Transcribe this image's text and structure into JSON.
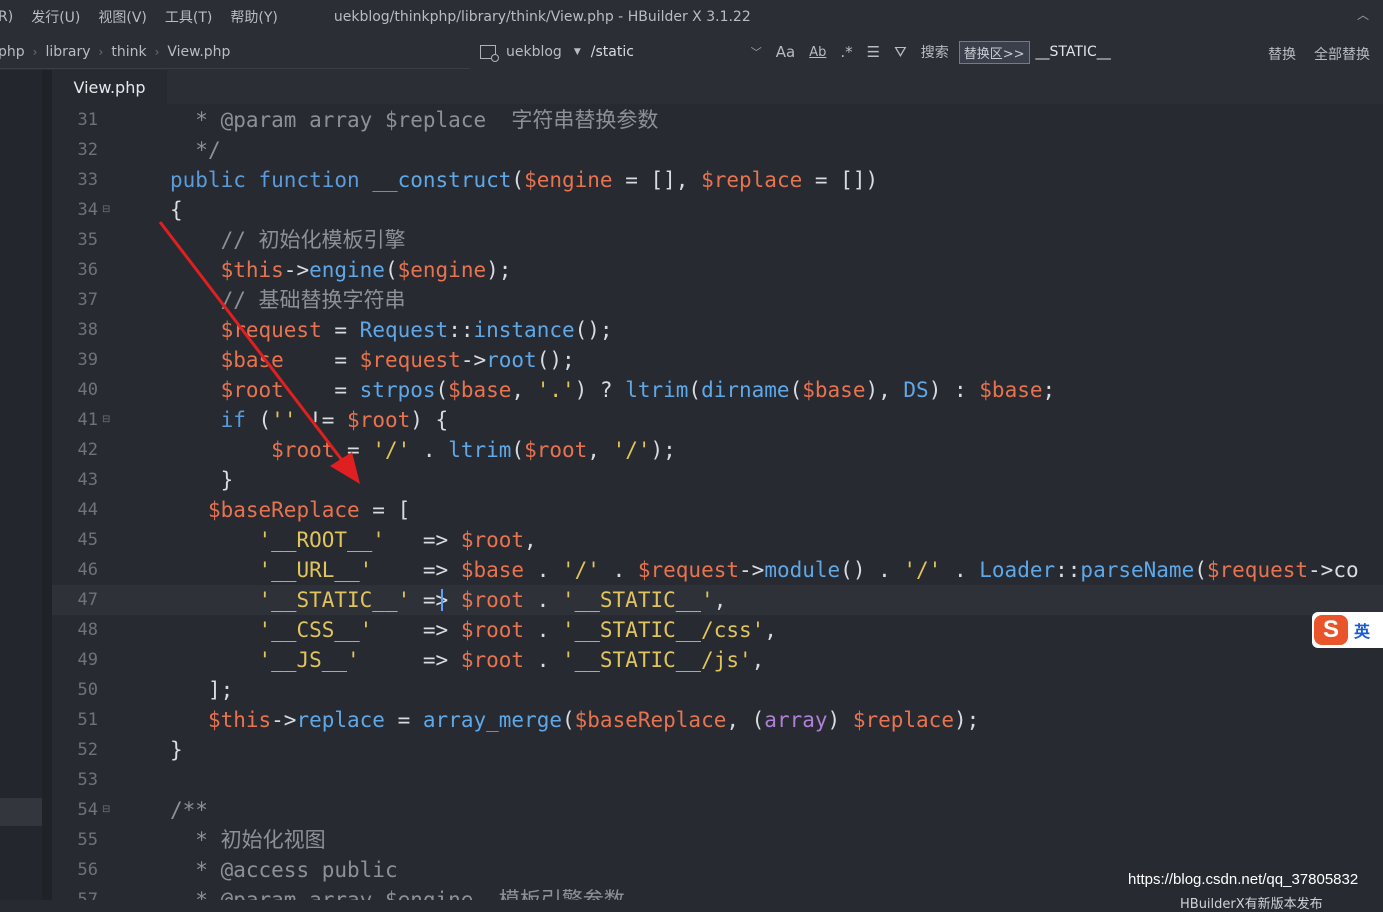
{
  "menubar": {
    "items": [
      "R)",
      "发行(U)",
      "视图(V)",
      "工具(T)",
      "帮助(Y)"
    ],
    "title": "uekblog/thinkphp/library/think/View.php - HBuilder X 3.1.22"
  },
  "breadcrumb": [
    "php",
    "library",
    "think",
    "View.php"
  ],
  "search": {
    "project": "uekblog",
    "value": "/static",
    "search_label": "搜索",
    "replace_toggle": "替换区>>",
    "replace_value": "__STATIC__",
    "replace_label": "替换",
    "replace_all_label": "全部替换"
  },
  "tab": {
    "label": "View.php"
  },
  "editor": {
    "lines": [
      {
        "n": "31",
        "fold": "",
        "tokens": [
          {
            "t": "comment",
            "v": "* @param array $replace  字符串替换参数"
          }
        ],
        "indent": "  "
      },
      {
        "n": "32",
        "fold": "",
        "tokens": [
          {
            "t": "comment",
            "v": "*/"
          }
        ],
        "indent": "  "
      },
      {
        "n": "33",
        "fold": "",
        "tokens": [
          {
            "t": "keyword",
            "v": "public"
          },
          {
            "t": "op",
            "v": " "
          },
          {
            "t": "keyword",
            "v": "function"
          },
          {
            "t": "op",
            "v": " "
          },
          {
            "t": "func",
            "v": "__construct"
          },
          {
            "t": "op",
            "v": "("
          },
          {
            "t": "variable",
            "v": "$engine"
          },
          {
            "t": "op",
            "v": " = [], "
          },
          {
            "t": "variable",
            "v": "$replace"
          },
          {
            "t": "op",
            "v": " = [])"
          }
        ],
        "indent": ""
      },
      {
        "n": "34",
        "fold": "⊟",
        "tokens": [
          {
            "t": "op",
            "v": "{"
          }
        ],
        "indent": ""
      },
      {
        "n": "35",
        "fold": "",
        "tokens": [
          {
            "t": "comment",
            "v": "// 初始化模板引擎"
          }
        ],
        "indent": "    "
      },
      {
        "n": "36",
        "fold": "",
        "tokens": [
          {
            "t": "variable",
            "v": "$this"
          },
          {
            "t": "op",
            "v": "->"
          },
          {
            "t": "func",
            "v": "engine"
          },
          {
            "t": "op",
            "v": "("
          },
          {
            "t": "variable",
            "v": "$engine"
          },
          {
            "t": "op",
            "v": ");"
          }
        ],
        "indent": "    "
      },
      {
        "n": "37",
        "fold": "",
        "tokens": [
          {
            "t": "comment",
            "v": "// 基础替换字符串"
          }
        ],
        "indent": "    "
      },
      {
        "n": "38",
        "fold": "",
        "tokens": [
          {
            "t": "variable",
            "v": "$request"
          },
          {
            "t": "op",
            "v": " = "
          },
          {
            "t": "class",
            "v": "Request"
          },
          {
            "t": "op",
            "v": "::"
          },
          {
            "t": "func",
            "v": "instance"
          },
          {
            "t": "op",
            "v": "();"
          }
        ],
        "indent": "    "
      },
      {
        "n": "39",
        "fold": "",
        "tokens": [
          {
            "t": "variable",
            "v": "$base"
          },
          {
            "t": "op",
            "v": "    = "
          },
          {
            "t": "variable",
            "v": "$request"
          },
          {
            "t": "op",
            "v": "->"
          },
          {
            "t": "func",
            "v": "root"
          },
          {
            "t": "op",
            "v": "();"
          }
        ],
        "indent": "    "
      },
      {
        "n": "40",
        "fold": "",
        "tokens": [
          {
            "t": "variable",
            "v": "$root"
          },
          {
            "t": "op",
            "v": "    = "
          },
          {
            "t": "func",
            "v": "strpos"
          },
          {
            "t": "op",
            "v": "("
          },
          {
            "t": "variable",
            "v": "$base"
          },
          {
            "t": "op",
            "v": ", "
          },
          {
            "t": "string",
            "v": "'.'"
          },
          {
            "t": "op",
            "v": ") ? "
          },
          {
            "t": "func",
            "v": "ltrim"
          },
          {
            "t": "op",
            "v": "("
          },
          {
            "t": "func",
            "v": "dirname"
          },
          {
            "t": "op",
            "v": "("
          },
          {
            "t": "variable",
            "v": "$base"
          },
          {
            "t": "op",
            "v": "), "
          },
          {
            "t": "func",
            "v": "DS"
          },
          {
            "t": "op",
            "v": ") : "
          },
          {
            "t": "variable",
            "v": "$base"
          },
          {
            "t": "op",
            "v": ";"
          }
        ],
        "indent": "    "
      },
      {
        "n": "41",
        "fold": "⊟",
        "tokens": [
          {
            "t": "keyword",
            "v": "if"
          },
          {
            "t": "op",
            "v": " ("
          },
          {
            "t": "string",
            "v": "''"
          },
          {
            "t": "op",
            "v": " != "
          },
          {
            "t": "variable",
            "v": "$root"
          },
          {
            "t": "op",
            "v": ") {"
          }
        ],
        "indent": "    "
      },
      {
        "n": "42",
        "fold": "",
        "tokens": [
          {
            "t": "variable",
            "v": "$root"
          },
          {
            "t": "op",
            "v": " = "
          },
          {
            "t": "string",
            "v": "'/'"
          },
          {
            "t": "op",
            "v": " . "
          },
          {
            "t": "func",
            "v": "ltrim"
          },
          {
            "t": "op",
            "v": "("
          },
          {
            "t": "variable",
            "v": "$root"
          },
          {
            "t": "op",
            "v": ", "
          },
          {
            "t": "string",
            "v": "'/'"
          },
          {
            "t": "op",
            "v": ");"
          }
        ],
        "indent": "        "
      },
      {
        "n": "43",
        "fold": "",
        "tokens": [
          {
            "t": "op",
            "v": "}"
          }
        ],
        "indent": "    "
      },
      {
        "n": "44",
        "fold": "",
        "tokens": [
          {
            "t": "variable",
            "v": "$baseReplace"
          },
          {
            "t": "op",
            "v": " = ["
          }
        ],
        "indent": "   "
      },
      {
        "n": "45",
        "fold": "",
        "tokens": [
          {
            "t": "string",
            "v": "'__ROOT__'"
          },
          {
            "t": "op",
            "v": "   => "
          },
          {
            "t": "variable",
            "v": "$root"
          },
          {
            "t": "op",
            "v": ","
          }
        ],
        "indent": "       "
      },
      {
        "n": "46",
        "fold": "",
        "tokens": [
          {
            "t": "string",
            "v": "'__URL__'"
          },
          {
            "t": "op",
            "v": "    => "
          },
          {
            "t": "variable",
            "v": "$base"
          },
          {
            "t": "op",
            "v": " . "
          },
          {
            "t": "string",
            "v": "'/'"
          },
          {
            "t": "op",
            "v": " . "
          },
          {
            "t": "variable",
            "v": "$request"
          },
          {
            "t": "op",
            "v": "->"
          },
          {
            "t": "func",
            "v": "module"
          },
          {
            "t": "op",
            "v": "() . "
          },
          {
            "t": "string",
            "v": "'/'"
          },
          {
            "t": "op",
            "v": " . "
          },
          {
            "t": "class",
            "v": "Loader"
          },
          {
            "t": "op",
            "v": "::"
          },
          {
            "t": "func",
            "v": "parseName"
          },
          {
            "t": "op",
            "v": "("
          },
          {
            "t": "variable",
            "v": "$request"
          },
          {
            "t": "op",
            "v": "->co"
          }
        ],
        "indent": "       "
      },
      {
        "n": "47",
        "fold": "",
        "tokens": [
          {
            "t": "string",
            "v": "'__STATIC__'"
          },
          {
            "t": "op",
            "v": " => "
          },
          {
            "t": "variable",
            "v": "$root"
          },
          {
            "t": "op",
            "v": " . "
          },
          {
            "t": "string",
            "v": "'__STATIC__'"
          },
          {
            "t": "op",
            "v": ","
          }
        ],
        "indent": "       ",
        "current": true
      },
      {
        "n": "48",
        "fold": "",
        "tokens": [
          {
            "t": "string",
            "v": "'__CSS__'"
          },
          {
            "t": "op",
            "v": "    => "
          },
          {
            "t": "variable",
            "v": "$root"
          },
          {
            "t": "op",
            "v": " . "
          },
          {
            "t": "string",
            "v": "'__STATIC__/css'"
          },
          {
            "t": "op",
            "v": ","
          }
        ],
        "indent": "       "
      },
      {
        "n": "49",
        "fold": "",
        "tokens": [
          {
            "t": "string",
            "v": "'__JS__'"
          },
          {
            "t": "op",
            "v": "     => "
          },
          {
            "t": "variable",
            "v": "$root"
          },
          {
            "t": "op",
            "v": " . "
          },
          {
            "t": "string",
            "v": "'__STATIC__/js'"
          },
          {
            "t": "op",
            "v": ","
          }
        ],
        "indent": "       "
      },
      {
        "n": "50",
        "fold": "",
        "tokens": [
          {
            "t": "op",
            "v": "];"
          }
        ],
        "indent": "   "
      },
      {
        "n": "51",
        "fold": "",
        "tokens": [
          {
            "t": "variable",
            "v": "$this"
          },
          {
            "t": "op",
            "v": "->"
          },
          {
            "t": "func",
            "v": "replace"
          },
          {
            "t": "op",
            "v": " = "
          },
          {
            "t": "func",
            "v": "array_merge"
          },
          {
            "t": "op",
            "v": "("
          },
          {
            "t": "variable",
            "v": "$baseReplace"
          },
          {
            "t": "op",
            "v": ", ("
          },
          {
            "t": "kw2",
            "v": "array"
          },
          {
            "t": "op",
            "v": ") "
          },
          {
            "t": "variable",
            "v": "$replace"
          },
          {
            "t": "op",
            "v": ");"
          }
        ],
        "indent": "   "
      },
      {
        "n": "52",
        "fold": "",
        "tokens": [
          {
            "t": "op",
            "v": "}"
          }
        ],
        "indent": ""
      },
      {
        "n": "53",
        "fold": "",
        "tokens": [],
        "indent": ""
      },
      {
        "n": "54",
        "fold": "⊟",
        "tokens": [
          {
            "t": "comment",
            "v": "/**"
          }
        ],
        "indent": ""
      },
      {
        "n": "55",
        "fold": "",
        "tokens": [
          {
            "t": "comment",
            "v": "* 初始化视图"
          }
        ],
        "indent": "  "
      },
      {
        "n": "56",
        "fold": "",
        "tokens": [
          {
            "t": "comment",
            "v": "* @access public"
          }
        ],
        "indent": "  "
      },
      {
        "n": "57",
        "fold": "",
        "tokens": [
          {
            "t": "comment",
            "v": "* @param array $engine  模板引擎参数"
          }
        ],
        "indent": "  "
      }
    ]
  },
  "watermark": "https://blog.csdn.net/qq_37805832",
  "bottom_cut_text": "HBuilderX有新版本发布",
  "ime": {
    "language": "英"
  },
  "colors": {
    "arrow": "#e02020",
    "cursor": "#5aa0ff"
  }
}
